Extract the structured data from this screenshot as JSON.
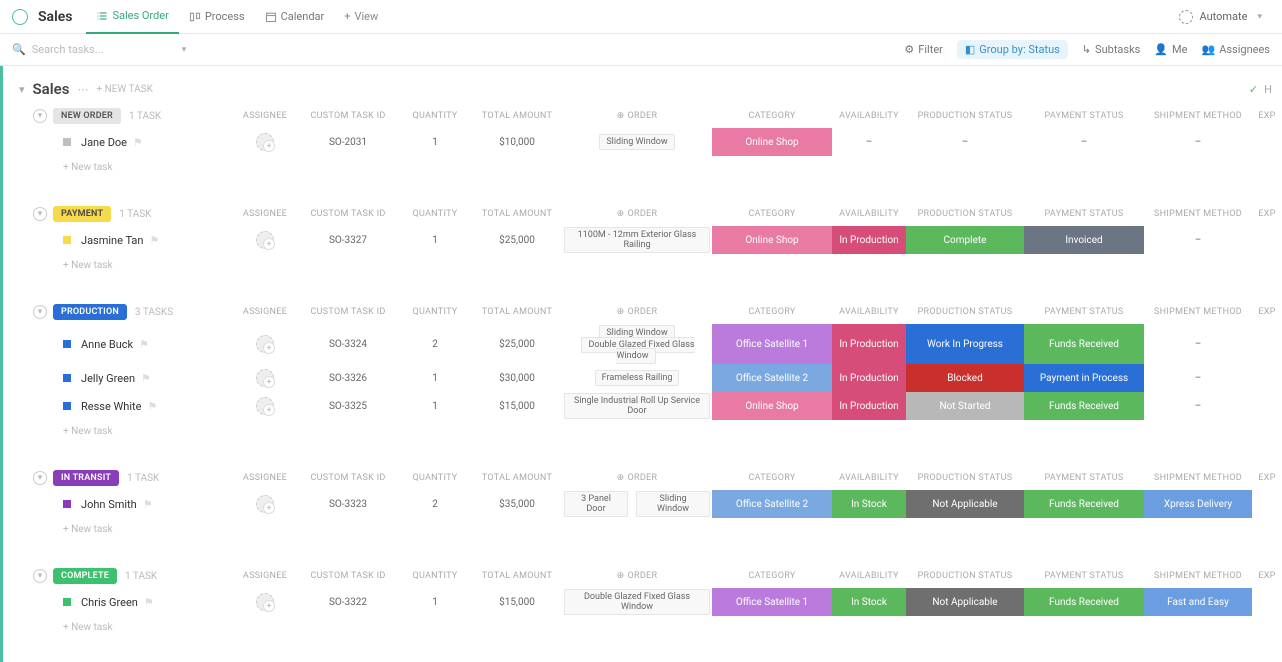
{
  "header": {
    "title": "Sales"
  },
  "tabs": [
    {
      "label": "Sales Order"
    },
    {
      "label": "Process"
    },
    {
      "label": "Calendar"
    }
  ],
  "add_view": "View",
  "automate": "Automate",
  "search_placeholder": "Search tasks...",
  "toolbar": {
    "filter": "Filter",
    "group": "Group by: Status",
    "subtasks": "Subtasks",
    "me": "Me",
    "assignees": "Assignees"
  },
  "list": {
    "name": "Sales",
    "new_task": "+ NEW TASK",
    "hide": "H"
  },
  "columns": {
    "assignee": "ASSIGNEE",
    "custom_task_id": "CUSTOM TASK ID",
    "quantity": "QUANTITY",
    "total_amount": "TOTAL AMOUNT",
    "order": "ORDER",
    "category": "CATEGORY",
    "availability": "AVAILABILITY",
    "production_status": "PRODUCTION STATUS",
    "payment_status": "PAYMENT STATUS",
    "shipment_method": "SHIPMENT METHOD",
    "exp": "EXP"
  },
  "new_task_row": "+ New task",
  "groups": [
    {
      "name": "NEW ORDER",
      "bg": "#e4e4e4",
      "fg": "#555",
      "count": "1 TASK",
      "rows": [
        {
          "sq": "#bfbfbf",
          "name": "Jane Doe",
          "cti": "SO-2031",
          "qty": "1",
          "amt": "$10,000",
          "order": [
            "Sliding Window"
          ],
          "cat": {
            "t": "Online Shop",
            "c": "#e87aa3"
          },
          "avail": {
            "t": "-"
          },
          "prod": {
            "t": "-"
          },
          "pay": {
            "t": "-"
          },
          "ship": {
            "t": "-"
          }
        }
      ]
    },
    {
      "name": "PAYMENT",
      "bg": "#f7d94c",
      "fg": "#444",
      "count": "1 TASK",
      "rows": [
        {
          "sq": "#f7d94c",
          "name": "Jasmine Tan",
          "cti": "SO-3327",
          "qty": "1",
          "amt": "$25,000",
          "order": [
            "1100M - 12mm Exterior Glass Railing"
          ],
          "cat": {
            "t": "Online Shop",
            "c": "#e87aa3"
          },
          "avail": {
            "t": "In Production",
            "c": "#d64d7a"
          },
          "prod": {
            "t": "Complete",
            "c": "#5cb85c"
          },
          "pay": {
            "t": "Invoiced",
            "c": "#6b7583"
          },
          "ship": {
            "t": "-"
          }
        }
      ]
    },
    {
      "name": "PRODUCTION",
      "bg": "#2a6fd6",
      "fg": "#fff",
      "count": "3 TASKS",
      "rows": [
        {
          "sq": "#2a6fd6",
          "name": "Anne Buck",
          "cti": "SO-3324",
          "qty": "2",
          "amt": "$25,000",
          "order": [
            "Sliding Window",
            "Double Glazed Fixed Glass Window"
          ],
          "cat": {
            "t": "Office Satellite 1",
            "c": "#bb7bdc"
          },
          "avail": {
            "t": "In Production",
            "c": "#d64d7a"
          },
          "prod": {
            "t": "Work In Progress",
            "c": "#2a6fd6"
          },
          "pay": {
            "t": "Funds Received",
            "c": "#5cb85c"
          },
          "ship": {
            "t": "-"
          }
        },
        {
          "sq": "#2a6fd6",
          "name": "Jelly Green",
          "cti": "SO-3326",
          "qty": "1",
          "amt": "$30,000",
          "order": [
            "Frameless Railing"
          ],
          "cat": {
            "t": "Office Satellite 2",
            "c": "#7aa8e0"
          },
          "avail": {
            "t": "In Production",
            "c": "#d64d7a"
          },
          "prod": {
            "t": "Blocked",
            "c": "#c9302c"
          },
          "pay": {
            "t": "Payment in Process",
            "c": "#2a6fd6"
          },
          "ship": {
            "t": "-"
          }
        },
        {
          "sq": "#2a6fd6",
          "name": "Resse White",
          "cti": "SO-3325",
          "qty": "1",
          "amt": "$15,000",
          "order": [
            "Single Industrial Roll Up Service Door"
          ],
          "cat": {
            "t": "Online Shop",
            "c": "#e87aa3"
          },
          "avail": {
            "t": "In Production",
            "c": "#d64d7a"
          },
          "prod": {
            "t": "Not Started",
            "c": "#b8b8b8"
          },
          "pay": {
            "t": "Funds Received",
            "c": "#5cb85c"
          },
          "ship": {
            "t": "-"
          }
        }
      ]
    },
    {
      "name": "IN TRANSIT",
      "bg": "#8a3db8",
      "fg": "#fff",
      "count": "1 TASK",
      "rows": [
        {
          "sq": "#8a3db8",
          "name": "John Smith",
          "cti": "SO-3323",
          "qty": "2",
          "amt": "$35,000",
          "order": [
            "3 Panel Door",
            "Sliding Window"
          ],
          "order_inline": true,
          "cat": {
            "t": "Office Satellite 2",
            "c": "#7aa8e0"
          },
          "avail": {
            "t": "In Stock",
            "c": "#5cb85c"
          },
          "prod": {
            "t": "Not Applicable",
            "c": "#6f6f6f"
          },
          "pay": {
            "t": "Funds Received",
            "c": "#5cb85c"
          },
          "ship": {
            "t": "Xpress Delivery",
            "c": "#6a9ee0"
          }
        }
      ]
    },
    {
      "name": "COMPLETE",
      "bg": "#3cc26e",
      "fg": "#fff",
      "count": "1 TASK",
      "rows": [
        {
          "sq": "#3cc26e",
          "name": "Chris Green",
          "cti": "SO-3322",
          "qty": "1",
          "amt": "$15,000",
          "order": [
            "Double Glazed Fixed Glass Window"
          ],
          "cat": {
            "t": "Office Satellite 1",
            "c": "#bb7bdc"
          },
          "avail": {
            "t": "In Stock",
            "c": "#5cb85c"
          },
          "prod": {
            "t": "Not Applicable",
            "c": "#6f6f6f"
          },
          "pay": {
            "t": "Funds Received",
            "c": "#5cb85c"
          },
          "ship": {
            "t": "Fast and Easy",
            "c": "#6a9ee0"
          }
        }
      ]
    }
  ]
}
